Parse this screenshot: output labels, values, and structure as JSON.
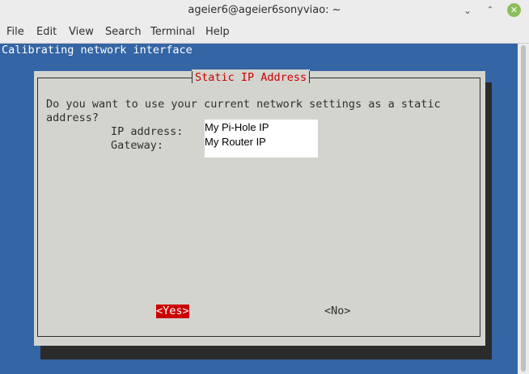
{
  "window": {
    "title": "ageier6@ageier6sonyviao: ~",
    "minimize_glyph": "⌄",
    "maximize_glyph": "⌃",
    "close_glyph": "✕"
  },
  "menu": {
    "items": [
      {
        "label": "File"
      },
      {
        "label": "Edit"
      },
      {
        "label": "View"
      },
      {
        "label": "Search"
      },
      {
        "label": "Terminal"
      },
      {
        "label": "Help"
      }
    ]
  },
  "terminal": {
    "backtitle": "Calibrating network interface",
    "dialog": {
      "title": "Static IP Address",
      "question_line1": "Do you want to use your current network settings as a static",
      "question_line2": "address?",
      "ip_label": "IP address:",
      "ip_value": "My Pi-Hole IP",
      "gateway_label": "Gateway:",
      "gateway_value": "My Router IP",
      "yes_label": "<Yes>",
      "no_label": "<No>"
    }
  },
  "colors": {
    "terminal_bg": "#3465a4",
    "dialog_bg": "#d4d4cf",
    "accent_red": "#cc0000",
    "chrome_bg": "#ececec"
  }
}
